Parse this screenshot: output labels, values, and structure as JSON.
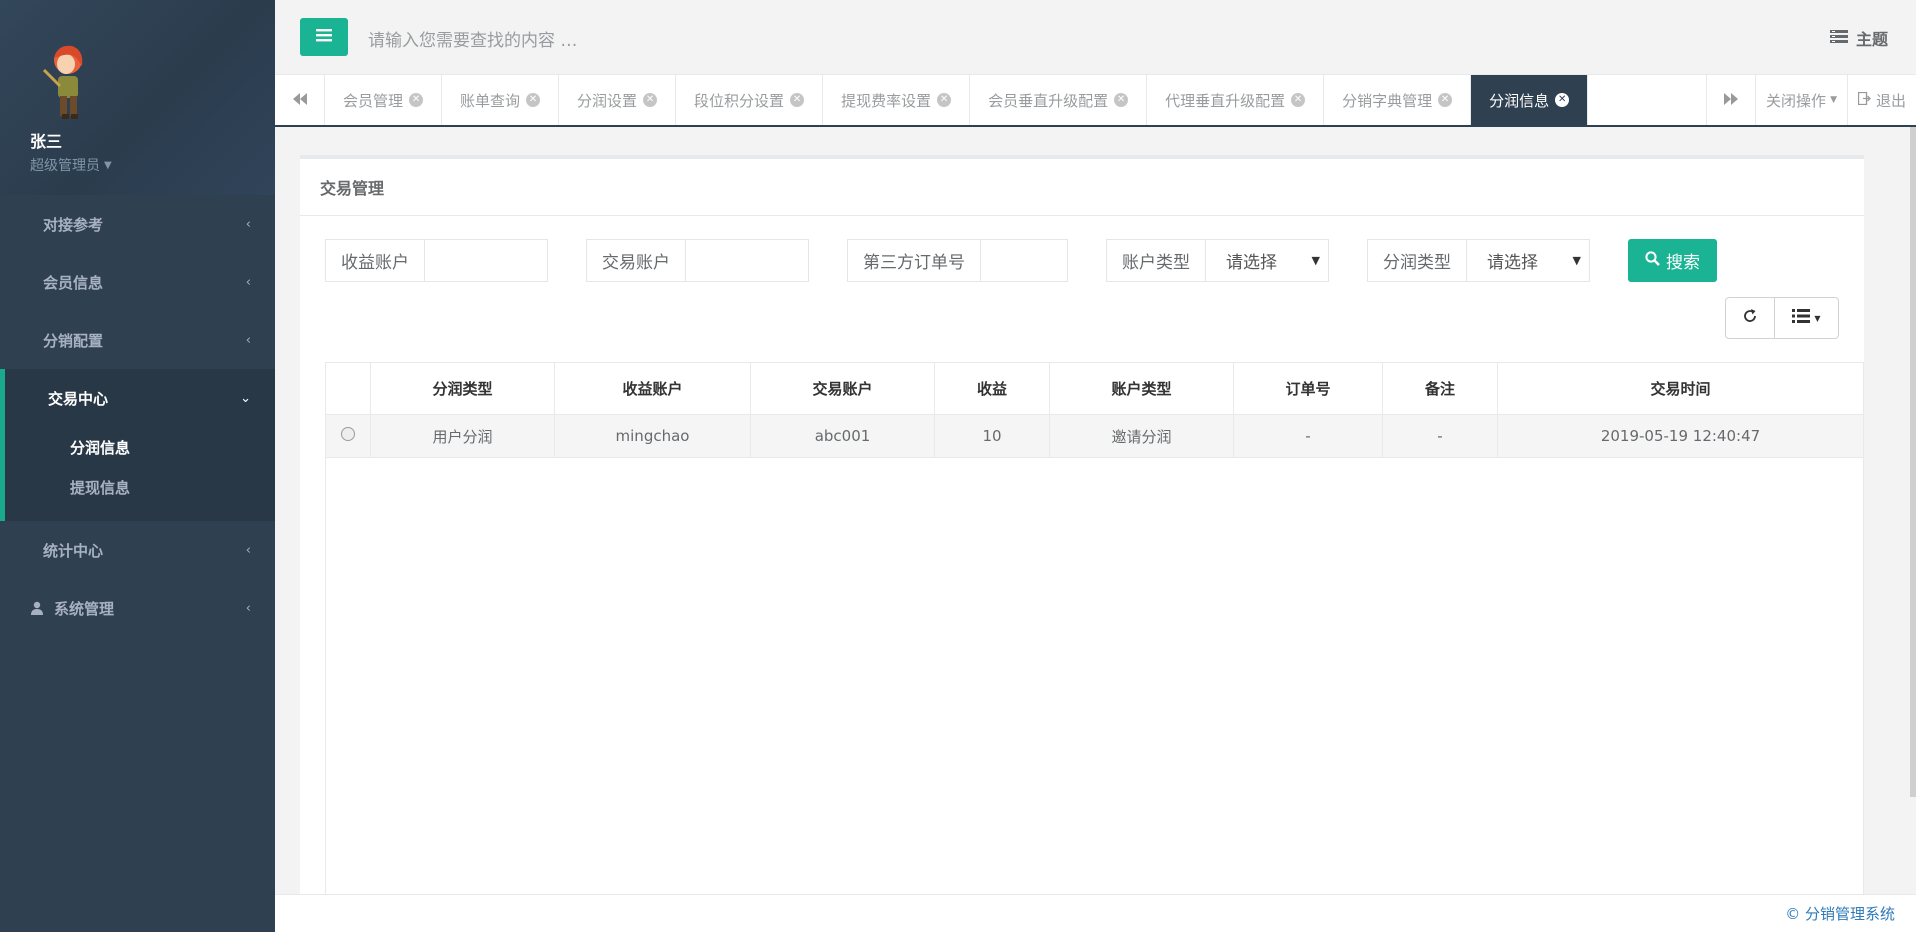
{
  "user": {
    "name": "张三",
    "role": "超级管理员"
  },
  "sidebar": {
    "items": [
      {
        "label": "对接参考"
      },
      {
        "label": "会员信息"
      },
      {
        "label": "分销配置"
      },
      {
        "label": "交易中心",
        "sub": [
          {
            "label": "分润信息"
          },
          {
            "label": "提现信息"
          }
        ]
      },
      {
        "label": "统计中心"
      },
      {
        "label": "系统管理"
      }
    ]
  },
  "topbar": {
    "search_placeholder": "请输入您需要查找的内容 …",
    "theme_label": "主题"
  },
  "tabs": [
    {
      "label": "会员管理"
    },
    {
      "label": "账单查询"
    },
    {
      "label": "分润设置"
    },
    {
      "label": "段位积分设置"
    },
    {
      "label": "提现费率设置"
    },
    {
      "label": "会员垂直升级配置"
    },
    {
      "label": "代理垂直升级配置"
    },
    {
      "label": "分销字典管理"
    },
    {
      "label": "分润信息"
    }
  ],
  "tab_actions": {
    "close_ops": "关闭操作",
    "logout": "退出"
  },
  "panel": {
    "title": "交易管理"
  },
  "filters": {
    "income_account": "收益账户",
    "trade_account": "交易账户",
    "third_order": "第三方订单号",
    "account_type": "账户类型",
    "profit_type": "分润类型",
    "select_placeholder": "请选择",
    "search_label": "搜索"
  },
  "table": {
    "headers": [
      "分润类型",
      "收益账户",
      "交易账户",
      "收益",
      "账户类型",
      "订单号",
      "备注",
      "交易时间"
    ],
    "rows": [
      [
        "用户分润",
        "mingchao",
        "abc001",
        "10",
        "邀请分润",
        "-",
        "-",
        "2019-05-19 12:40:47"
      ]
    ]
  },
  "footer": {
    "copyright": "© 分销管理系统"
  },
  "colors": {
    "sidebar_bg": "#2f4050",
    "accent": "#1ab394"
  }
}
